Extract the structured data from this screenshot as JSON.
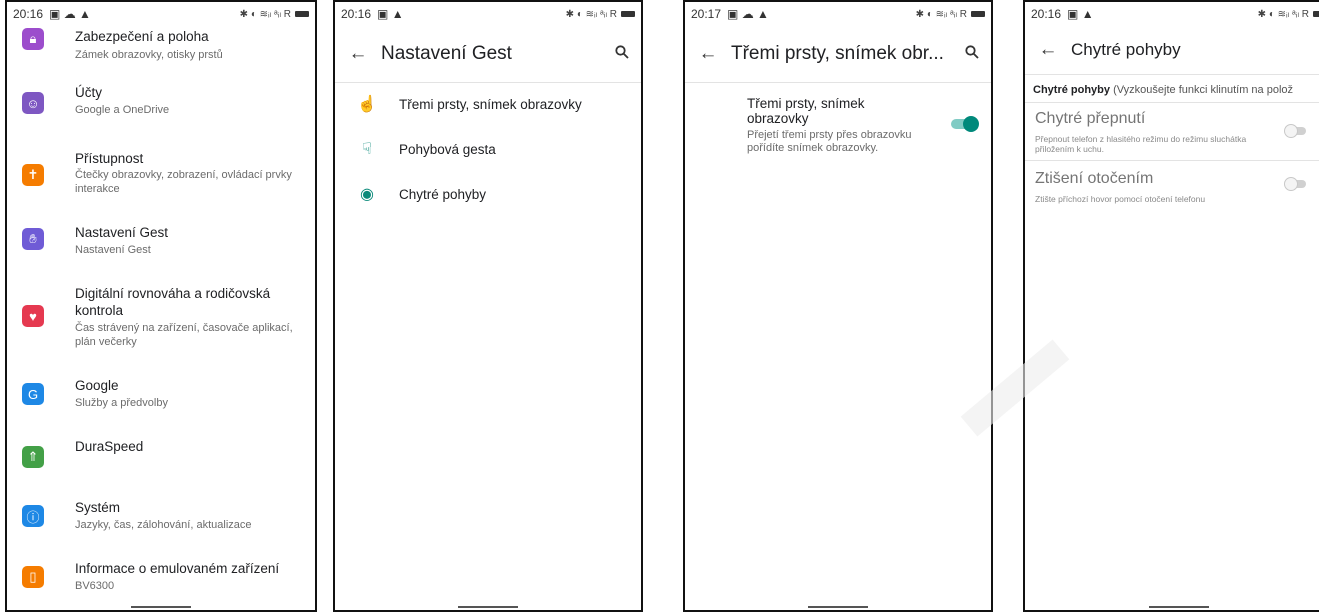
{
  "status_bar": {
    "panel1_time": "20:16",
    "panel2_time": "20:16",
    "panel3_time": "20:17",
    "panel4_time": "20:16",
    "right_glyphs": "✱ ◐ ≋ᵢₗ ᵃᵢₗ R"
  },
  "panel1": {
    "items": [
      {
        "title": "Zabezpečení a poloha",
        "subtitle": "Zámek obrazovky, otisky prstů",
        "icon": "lock-icon",
        "color": "#9c4dcc"
      },
      {
        "title": "Účty",
        "subtitle": "Google a OneDrive",
        "icon": "account-icon",
        "color": "#7e57c2"
      },
      {
        "title": "Přístupnost",
        "subtitle": "Čtečky obrazovky, zobrazení, ovládací prvky interakce",
        "icon": "accessibility-icon",
        "color": "#f57c00"
      },
      {
        "title": "Nastavení Gest",
        "subtitle": "Nastavení Gest",
        "icon": "hand-gesture-icon",
        "color": "#6f5bd6"
      },
      {
        "title": "Digitální rovnováha a rodičovská kontrola",
        "subtitle": "Čas strávený na zařízení, časovače aplikací, plán večerky",
        "icon": "heart-plus-icon",
        "color": "#e53950"
      },
      {
        "title": "Google",
        "subtitle": "Služby a předvolby",
        "icon": "google-g-icon",
        "color": "#1e88e5"
      },
      {
        "title": "DuraSpeed",
        "subtitle": "",
        "icon": "rocket-icon",
        "color": "#43a047"
      },
      {
        "title": "Systém",
        "subtitle": "Jazyky, čas, zálohování, aktualizace",
        "icon": "info-icon",
        "color": "#1e88e5"
      },
      {
        "title": "Informace o emulovaném zařízení",
        "subtitle": "BV6300",
        "icon": "phone-icon",
        "color": "#f57c00"
      }
    ]
  },
  "panel2": {
    "title": "Nastavení Gest",
    "items": [
      {
        "label": "Třemi prsty, snímek obrazovky",
        "icon": "three-finger-icon"
      },
      {
        "label": "Pohybová gesta",
        "icon": "swipe-hand-icon"
      },
      {
        "label": "Chytré pohyby",
        "icon": "smart-motion-icon"
      }
    ]
  },
  "panel3": {
    "title": "Třemi prsty, snímek obr...",
    "setting_title": "Třemi prsty, snímek obrazovky",
    "setting_desc": "Přejetí třemi prsty přes obrazovku pořídíte snímek obrazovky.",
    "toggle_on": true
  },
  "panel4": {
    "title": "Chytré pohyby",
    "crumb_bold": "Chytré pohyby",
    "crumb_rest": " (Vyzkoušejte funkci klinutím na polož",
    "settings": [
      {
        "title": "Chytré přepnutí",
        "desc": "Přepnout telefon z hlasitého režimu do režimu sluchátka přiložením k uchu.",
        "enabled": false
      },
      {
        "title": "Ztišení otočením",
        "desc": "Ztište příchozí hovor pomocí otočení telefonu",
        "enabled": false
      }
    ]
  },
  "colors": {
    "accent": "#00897b",
    "accent_light": "#80cbc4"
  }
}
